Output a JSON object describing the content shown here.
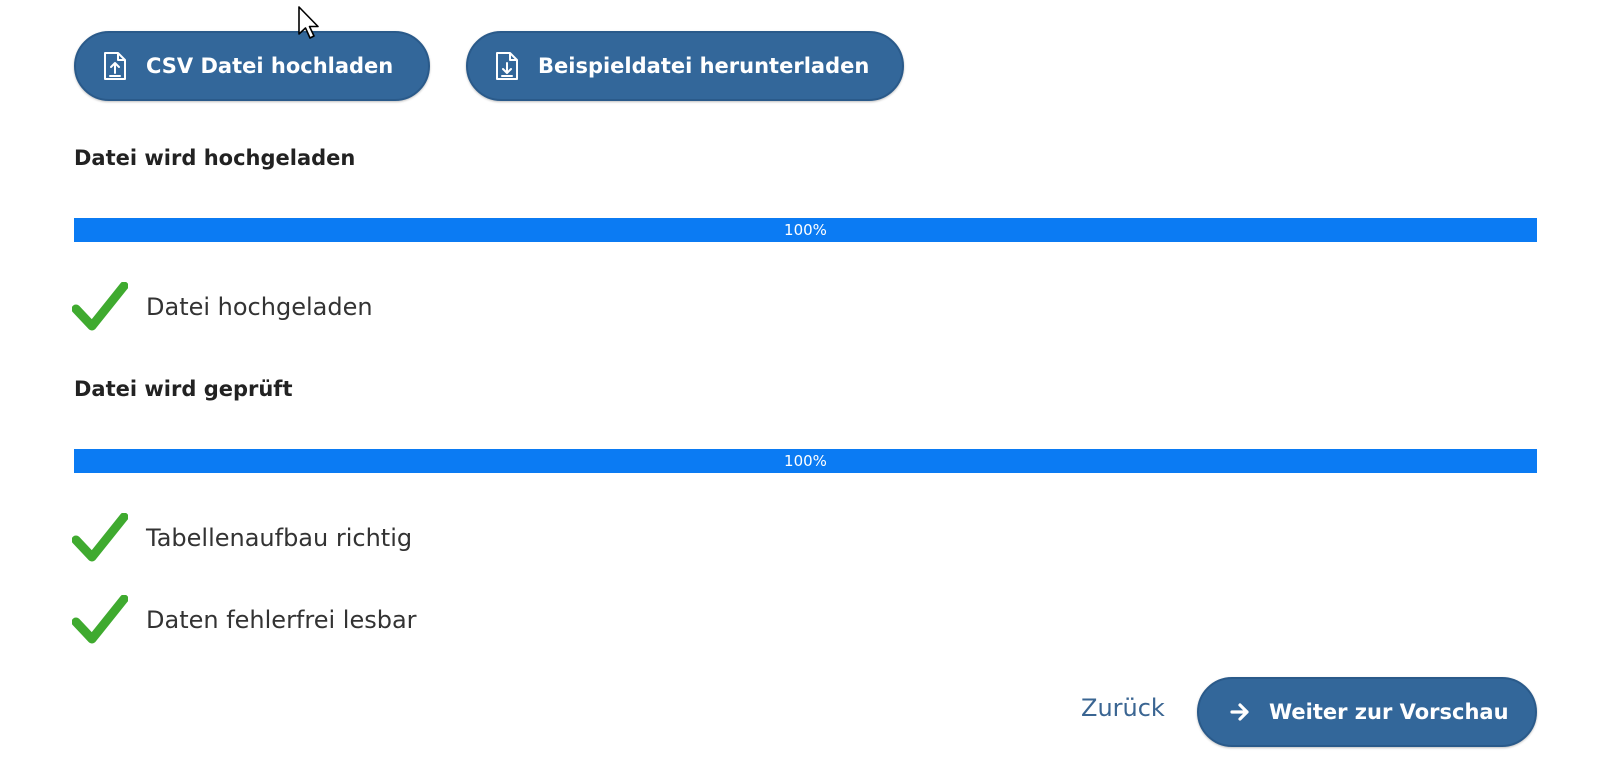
{
  "toolbar": {
    "csv_upload_label": "CSV Datei hochladen",
    "csv_upload_icon": "upload-file-icon",
    "sample_download_label": "Beispieldatei herunterladen",
    "sample_download_icon": "download-file-icon"
  },
  "upload_section": {
    "heading": "Datei wird hochgeladen",
    "progress_percent": 100,
    "progress_label": "100%",
    "result": {
      "text": "Datei hochgeladen",
      "icon": "checkmark-icon"
    }
  },
  "check_section": {
    "heading": "Datei wird geprüft",
    "progress_percent": 100,
    "progress_label": "100%",
    "results": [
      {
        "text": "Tabellenaufbau richtig",
        "icon": "checkmark-icon"
      },
      {
        "text": "Daten fehlerfrei lesbar",
        "icon": "checkmark-icon"
      }
    ]
  },
  "footer": {
    "back_label": "Zurück",
    "next_label": "Weiter zur Vorschau",
    "next_icon": "arrow-right-icon"
  },
  "colors": {
    "button_blue": "#33679a",
    "progress_blue": "#0b7bf3",
    "check_green": "#3faa2f",
    "link_blue": "#3a6592"
  }
}
